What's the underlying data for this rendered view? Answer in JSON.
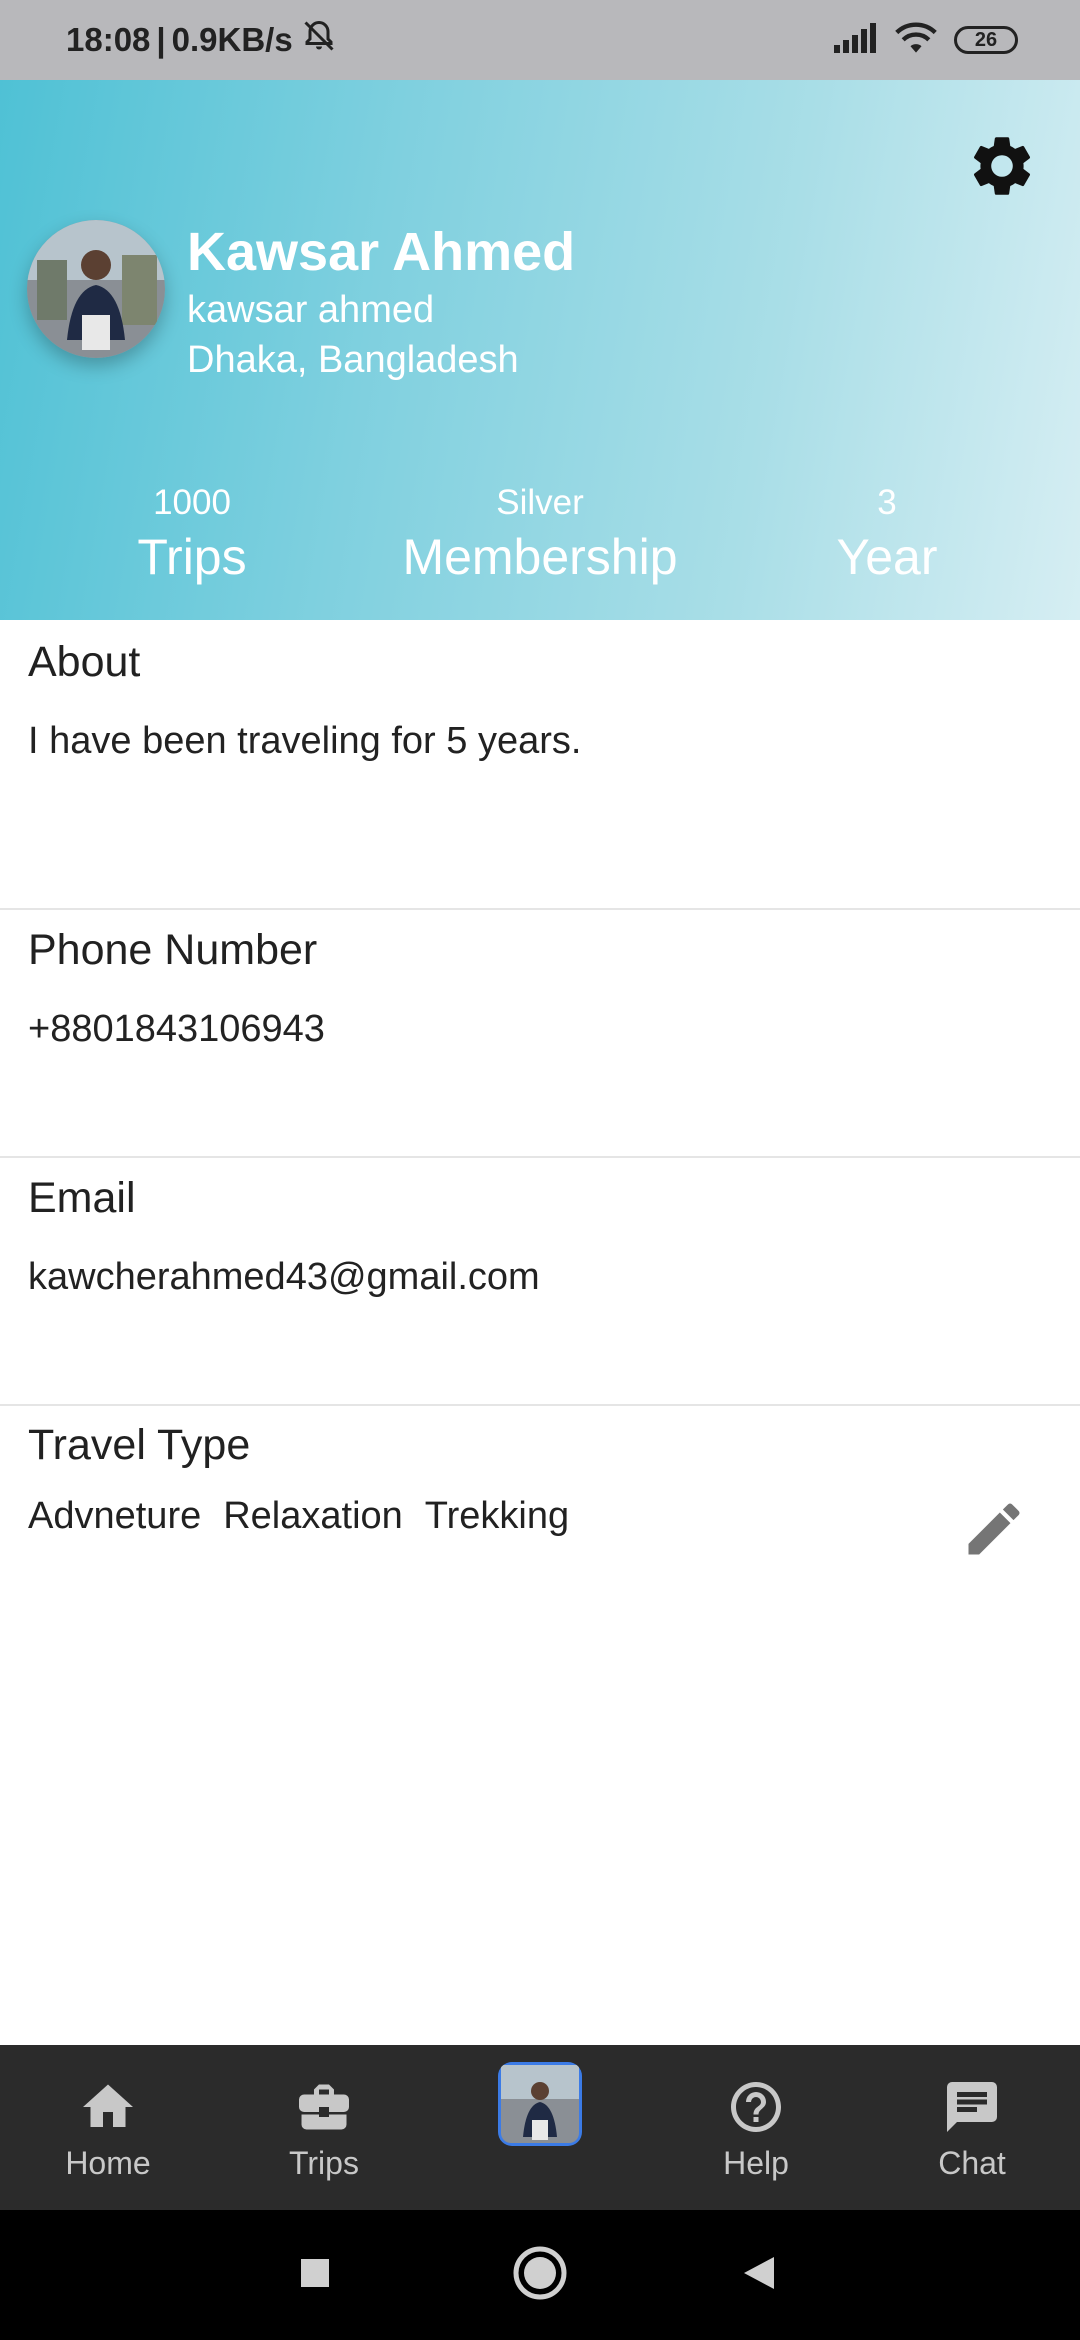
{
  "status_bar": {
    "time": "18:08",
    "separator": "|",
    "speed": "0.9KB/s",
    "battery": "26"
  },
  "profile": {
    "name": "Kawsar Ahmed",
    "username": "kawsar ahmed",
    "location": "Dhaka, Bangladesh"
  },
  "stats": [
    {
      "value": "1000",
      "label": "Trips"
    },
    {
      "value": "Silver",
      "label": "Membership"
    },
    {
      "value": "3",
      "label": "Year"
    }
  ],
  "about": {
    "title": "About",
    "value": "I have been traveling for 5 years."
  },
  "phone": {
    "title": "Phone Number",
    "value": "+8801843106943"
  },
  "email": {
    "title": "Email",
    "value": "kawcherahmed43@gmail.com"
  },
  "travel_type": {
    "title": "Travel Type",
    "tags": [
      "Advneture",
      "Relaxation",
      "Trekking"
    ]
  },
  "bottom_nav": {
    "home": "Home",
    "trips": "Trips",
    "help": "Help",
    "chat": "Chat"
  },
  "colors": {
    "header_start": "#4fc1d5",
    "header_end": "#d6eef3",
    "nav_bg": "#2b2b2b"
  },
  "icons": [
    "gear-icon",
    "pencil-icon",
    "home-icon",
    "briefcase-icon",
    "help-icon",
    "chat-icon",
    "signal-icon",
    "wifi-icon",
    "bell-off-icon"
  ]
}
